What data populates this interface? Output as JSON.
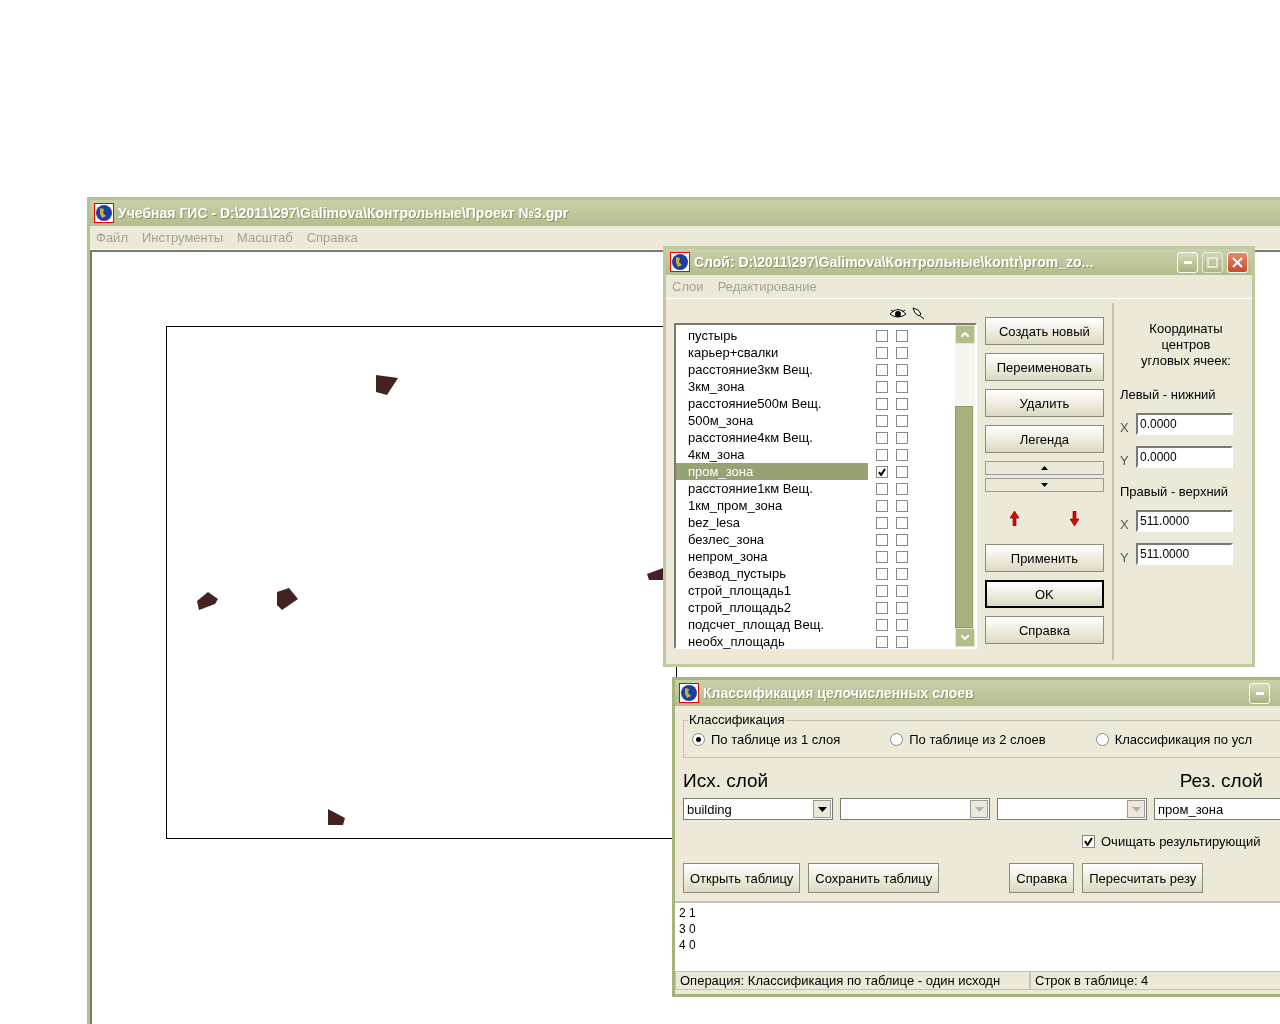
{
  "main_window": {
    "title": "Учебная ГИС - D:\\2011\\297\\Galimova\\Контрольные\\Проект №3.gpr",
    "menu": [
      "Файл",
      "Инструменты",
      "Масштаб",
      "Справка"
    ]
  },
  "layer_dialog": {
    "title": "Слой: D:\\2011\\297\\Galimova\\Контрольные\\kontr\\prom_zo...",
    "menu": [
      "Слои",
      "Редактирование"
    ],
    "layers": [
      {
        "name": "пустырь",
        "selected": false,
        "shown": false,
        "pinned": false
      },
      {
        "name": "карьер+свалки",
        "selected": false,
        "shown": false,
        "pinned": false
      },
      {
        "name": "расстояние3км Вещ.",
        "selected": false,
        "shown": false,
        "pinned": false
      },
      {
        "name": "3км_зона",
        "selected": false,
        "shown": false,
        "pinned": false
      },
      {
        "name": "расстояние500м Вещ.",
        "selected": false,
        "shown": false,
        "pinned": false
      },
      {
        "name": "500м_зона",
        "selected": false,
        "shown": false,
        "pinned": false
      },
      {
        "name": "расстояние4км Вещ.",
        "selected": false,
        "shown": false,
        "pinned": false
      },
      {
        "name": "4км_зона",
        "selected": false,
        "shown": false,
        "pinned": false
      },
      {
        "name": "пром_зона",
        "selected": true,
        "shown": true,
        "pinned": false
      },
      {
        "name": "расстояние1км Вещ.",
        "selected": false,
        "shown": false,
        "pinned": false
      },
      {
        "name": "1км_пром_зона",
        "selected": false,
        "shown": false,
        "pinned": false
      },
      {
        "name": "bez_lesa",
        "selected": false,
        "shown": false,
        "pinned": false
      },
      {
        "name": "безлес_зона",
        "selected": false,
        "shown": false,
        "pinned": false
      },
      {
        "name": "непром_зона",
        "selected": false,
        "shown": false,
        "pinned": false
      },
      {
        "name": "безвод_пустырь",
        "selected": false,
        "shown": false,
        "pinned": false
      },
      {
        "name": "строй_площадь1",
        "selected": false,
        "shown": false,
        "pinned": false
      },
      {
        "name": "строй_площадь2",
        "selected": false,
        "shown": false,
        "pinned": false
      },
      {
        "name": "подсчет_площад Вещ.",
        "selected": false,
        "shown": false,
        "pinned": false
      },
      {
        "name": "необх_площадь",
        "selected": false,
        "shown": false,
        "pinned": false
      }
    ],
    "top_buttons": [
      "Создать новый",
      "Переименовать",
      "Удалить",
      "Легенда"
    ],
    "bottom_buttons": [
      {
        "label": "Применить",
        "default": false
      },
      {
        "label": "OK",
        "default": true
      },
      {
        "label": "Справка",
        "default": false
      }
    ],
    "coords": {
      "heading": "Координаты центров угловых ячеек:",
      "groups": [
        {
          "label": "Левый - нижний",
          "fields": [
            {
              "axis": "X",
              "value": "0.0000"
            },
            {
              "axis": "Y",
              "value": "0.0000"
            }
          ]
        },
        {
          "label": "Правый - верхний",
          "fields": [
            {
              "axis": "X",
              "value": "511.0000"
            },
            {
              "axis": "Y",
              "value": "511.0000"
            }
          ]
        }
      ]
    }
  },
  "classification_dialog": {
    "title": "Классификация целочисленных слоев",
    "group_label": "Классификация",
    "modes": [
      {
        "label": "По таблице из 1 слоя",
        "selected": true
      },
      {
        "label": "По таблице из 2 слоев",
        "selected": false
      },
      {
        "label": "Классификация по усл",
        "selected": false
      }
    ],
    "source_label": "Исх. слой",
    "result_label": "Рез. слой",
    "source_combos": [
      {
        "value": "building",
        "disabled": false
      },
      {
        "disabled": true
      },
      {
        "disabled": true
      }
    ],
    "result_value": "пром_зона",
    "clear_option": {
      "label": "Очищать результирующий",
      "checked": true
    },
    "buttons": [
      "Открыть таблицу",
      "Сохранить таблицу",
      "Справка",
      "Пересчитать резу"
    ],
    "table_lines": [
      "2 1",
      "3 0",
      "4 0"
    ],
    "status_bar": [
      "Операция: Классификация по таблице - один исходн",
      "Строк в таблице: 4"
    ]
  }
}
